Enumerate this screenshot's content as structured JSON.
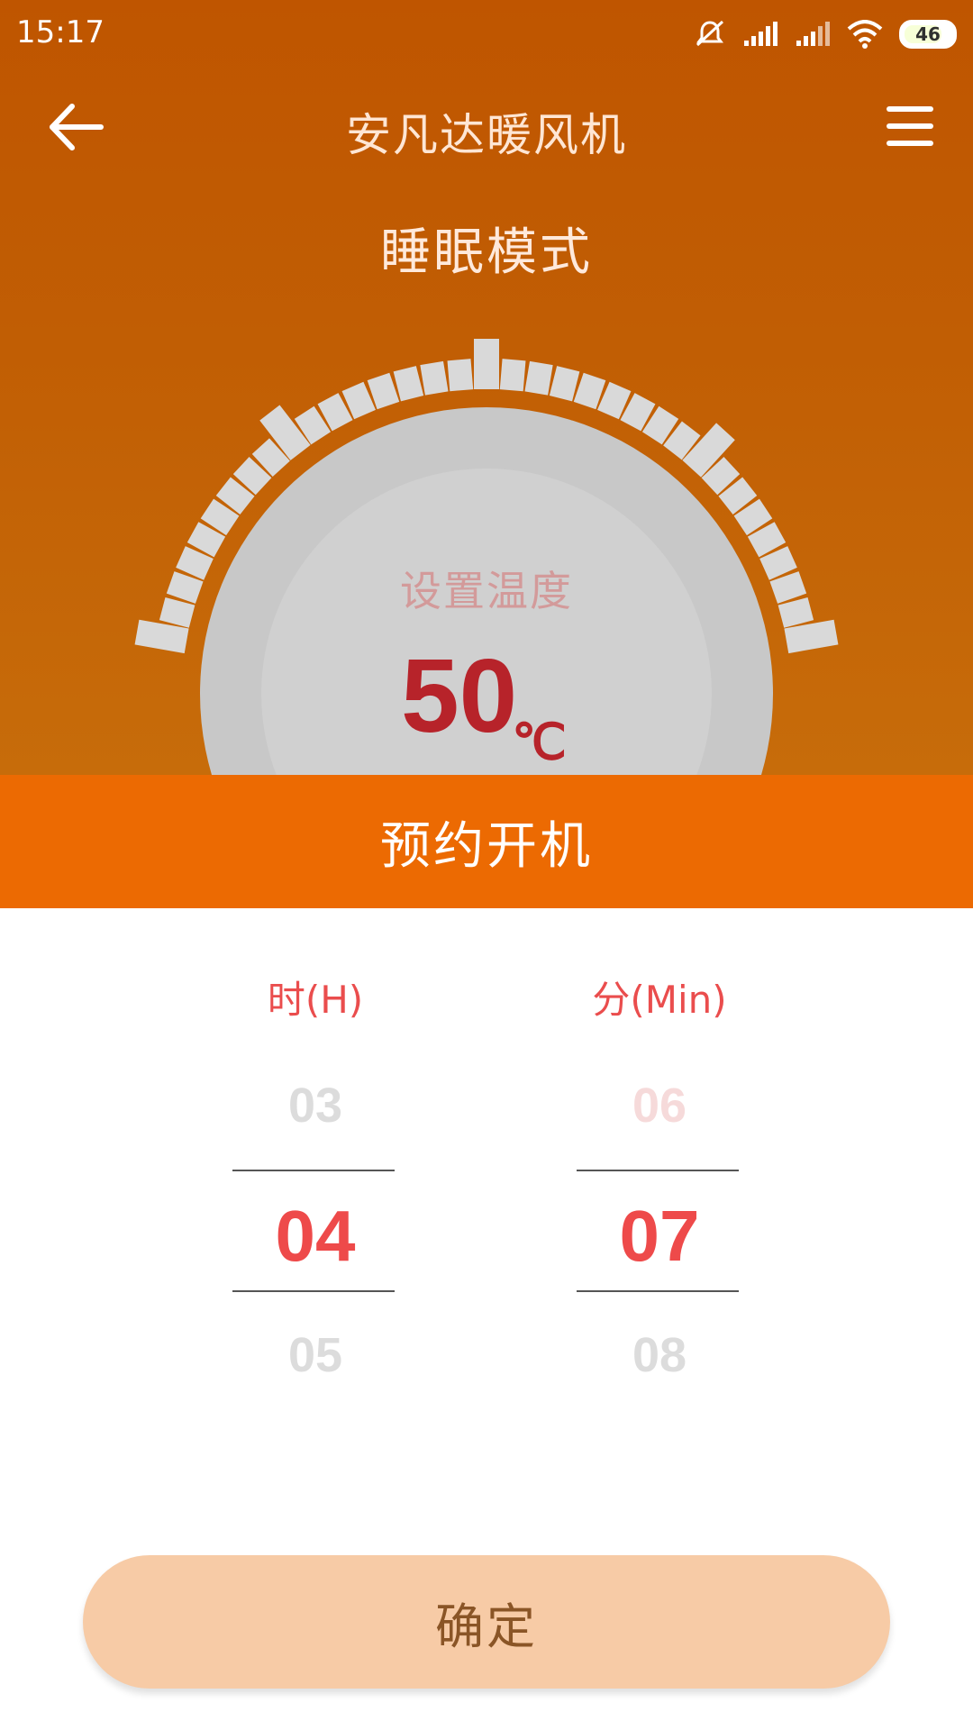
{
  "status_bar": {
    "time": "15:17",
    "battery": "46",
    "icons": [
      "mute-alarm-icon",
      "signal-icon",
      "signal-icon",
      "wifi-icon",
      "battery-icon"
    ]
  },
  "header": {
    "title": "安凡达暖风机",
    "back_icon": "arrow-left-icon",
    "menu_icon": "hamburger-menu-icon"
  },
  "mode": {
    "label": "睡眠模式"
  },
  "dial": {
    "set_temp_label": "设置温度",
    "temp_value": "50",
    "temp_unit": "℃"
  },
  "booking": {
    "title": "预约开机"
  },
  "picker": {
    "hour": {
      "header": "时(H)",
      "prev": "03",
      "current": "04",
      "next": "05"
    },
    "minute": {
      "header": "分(Min)",
      "prev": "06",
      "current": "07",
      "next": "08"
    }
  },
  "confirm": {
    "label": "确定"
  },
  "colors": {
    "top_bg": "#bf5500",
    "booking_bar": "#ec6a02",
    "accent_red": "#ee4a4a",
    "confirm_bg": "#f7cba6"
  }
}
